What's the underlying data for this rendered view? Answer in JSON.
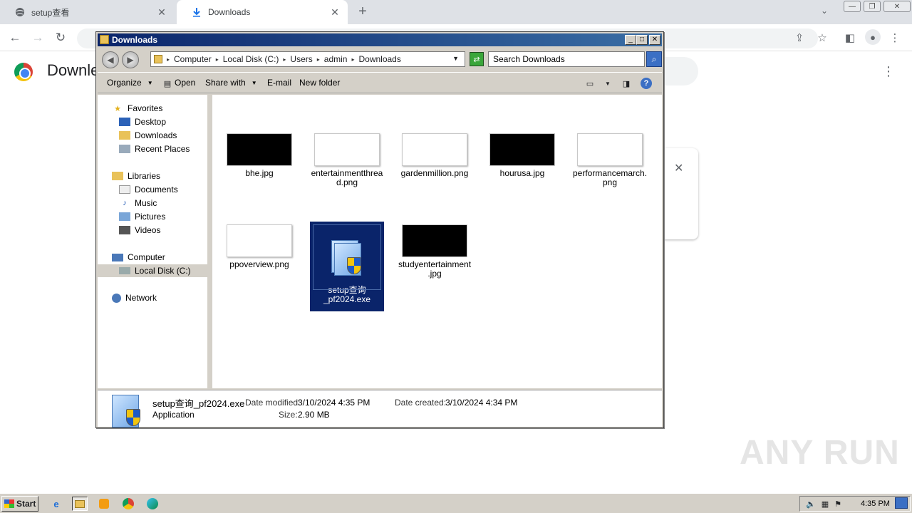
{
  "browser": {
    "tabs": [
      {
        "label": "setup查看",
        "icon": "globe-icon"
      },
      {
        "label": "Downloads",
        "icon": "download-icon"
      }
    ],
    "page_title": "Downle"
  },
  "explorer": {
    "title": "Downloads",
    "breadcrumb": [
      "Computer",
      "Local Disk (C:)",
      "Users",
      "admin",
      "Downloads"
    ],
    "search_placeholder": "Search Downloads",
    "commands": {
      "organize": "Organize",
      "open": "Open",
      "share_with": "Share with",
      "email": "E-mail",
      "new_folder": "New folder"
    },
    "nav": {
      "favorites": "Favorites",
      "desktop": "Desktop",
      "downloads": "Downloads",
      "recent": "Recent Places",
      "libraries": "Libraries",
      "documents": "Documents",
      "music": "Music",
      "pictures": "Pictures",
      "videos": "Videos",
      "computer": "Computer",
      "localdisk": "Local Disk (C:)",
      "network": "Network"
    },
    "files": [
      {
        "name": "bhe.jpg"
      },
      {
        "name": "entertainmentthread.png"
      },
      {
        "name": "gardenmillion.png"
      },
      {
        "name": "hourusa.jpg"
      },
      {
        "name": "performancemarch.png"
      },
      {
        "name": "ppoverview.png"
      },
      {
        "name": "setup查询_pf2024.exe"
      },
      {
        "name": "studyentertainment.jpg"
      }
    ],
    "file_lines": {
      "f1a": "entertainmentthrea",
      "f1b": "d.png",
      "f4a": "performancemarch.",
      "f4b": "png",
      "f6a": "setup查询",
      "f6b": "_pf2024.exe",
      "f7a": "studyentertainment",
      "f7b": ".jpg"
    },
    "details": {
      "name": "setup查询_pf2024.exe",
      "type": "Application",
      "modified_label": "Date modified:",
      "modified": "3/10/2024 4:35 PM",
      "created_label": "Date created:",
      "created": "3/10/2024 4:34 PM",
      "size_label": "Size:",
      "size": "2.90 MB"
    }
  },
  "taskbar": {
    "start": "Start",
    "clock": "4:35 PM"
  },
  "watermark": "ANY RUN"
}
